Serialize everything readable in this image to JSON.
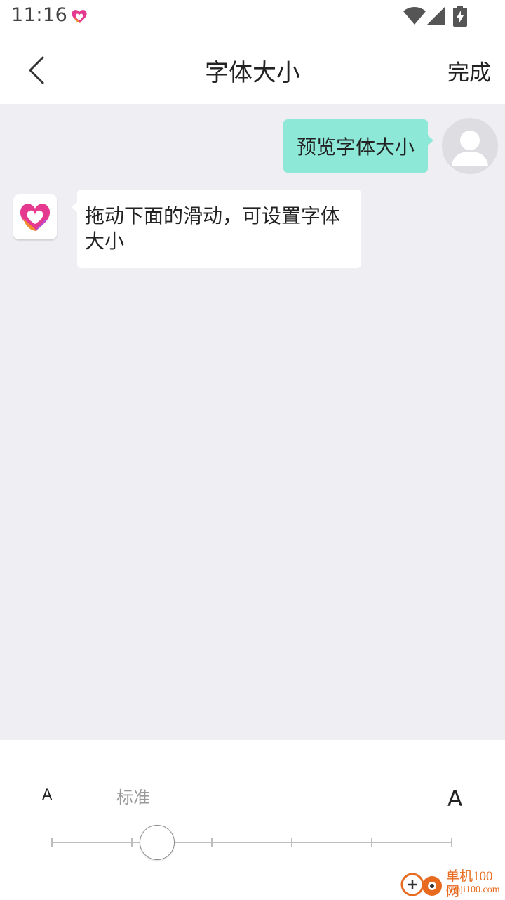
{
  "status_bar": {
    "time": "11:16",
    "icons": [
      "app-heart-icon",
      "wifi-icon",
      "signal-icon",
      "battery-charging-icon"
    ]
  },
  "nav": {
    "back_icon": "chevron-left-icon",
    "title": "字体大小",
    "done_label": "完成"
  },
  "chat": {
    "sent_message": "预览字体大小",
    "received_message": "拖动下面的滑动，可设置字体大小"
  },
  "font_slider": {
    "small_label": "A",
    "standard_label": "标准",
    "large_label": "A",
    "steps": 6,
    "selected_index": 1
  },
  "watermark": {
    "text": "单机100网",
    "url": "danji100.com"
  },
  "colors": {
    "sent_bubble": "#8ee8d8",
    "chat_background": "#efeef3",
    "watermark": "#e86a1e"
  }
}
